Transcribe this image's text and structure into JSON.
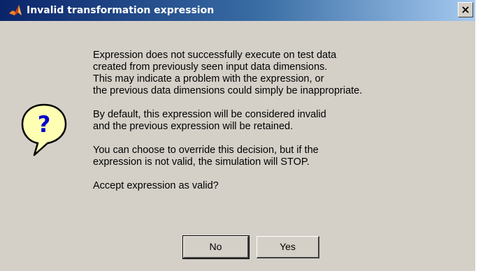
{
  "window": {
    "title": "Invalid transformation expression",
    "close_glyph": "×",
    "title_icon": "matlab-logo-icon"
  },
  "dialog": {
    "icon": "question-icon",
    "icon_glyph": "?",
    "paragraphs": [
      [
        "Expression does not successfully execute on test data",
        "created from previously seen input data dimensions.",
        "This may indicate a problem with the expression, or",
        "the previous data dimensions could simply be inappropriate."
      ],
      [
        "By default, this expression will be considered invalid",
        "and the previous expression will be retained."
      ],
      [
        "You can choose to override this decision, but if the",
        "expression is not valid, the simulation will STOP."
      ],
      [
        "Accept expression as valid?"
      ]
    ]
  },
  "buttons": {
    "no_label": "No",
    "yes_label": "Yes"
  },
  "colors": {
    "titlebar_start": "#0a246a",
    "titlebar_end": "#a6caf0",
    "face": "#d4d0c8",
    "icon_fill": "#ffffb4",
    "icon_mark": "#0000cc"
  }
}
